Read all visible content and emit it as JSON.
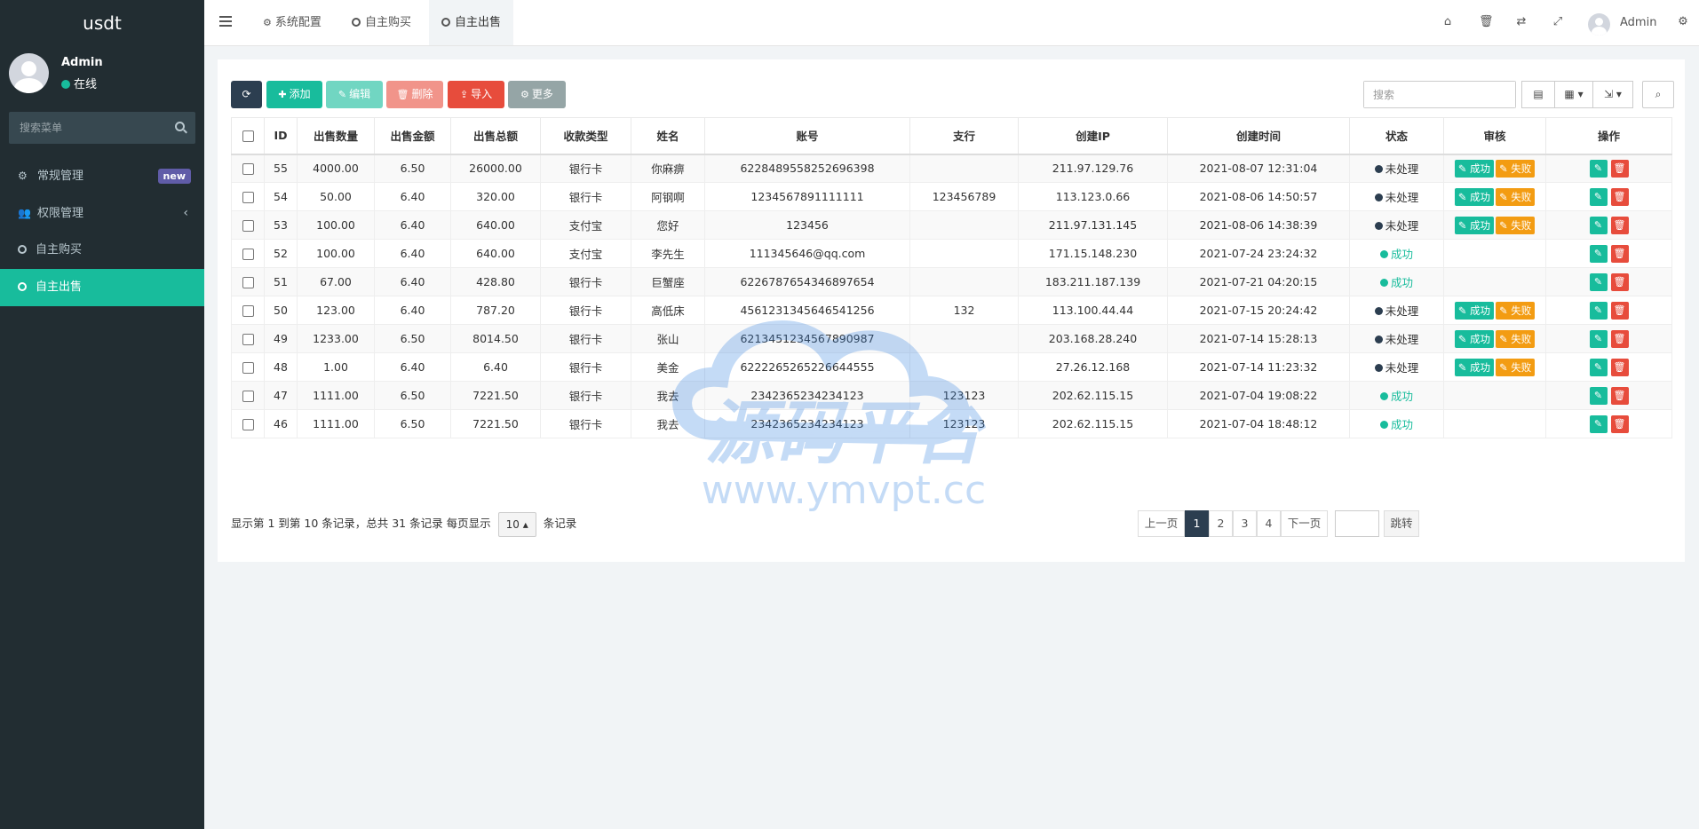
{
  "app": {
    "brand": "usdt"
  },
  "user": {
    "name": "Admin",
    "status": "在线"
  },
  "sidebar": {
    "search_placeholder": "搜索菜单",
    "items": [
      {
        "label": "常规管理",
        "icon": "cogs-icon",
        "badge": "new"
      },
      {
        "label": "权限管理",
        "icon": "users-icon",
        "chevron": "‹"
      },
      {
        "label": "自主购买",
        "icon": "circle-icon"
      },
      {
        "label": "自主出售",
        "icon": "circle-icon",
        "active": true
      }
    ]
  },
  "header": {
    "tabs": [
      {
        "label": "系统配置",
        "icon": "gear-icon"
      },
      {
        "label": "自主购买",
        "icon": "circle-icon"
      },
      {
        "label": "自主出售",
        "icon": "circle-icon",
        "active": true
      }
    ],
    "user_name": "Admin",
    "icons": [
      "home-icon",
      "trash-icon",
      "translate-icon",
      "fullscreen-icon",
      "settings-icon"
    ]
  },
  "toolbar": {
    "refresh_label": "",
    "add_label": "添加",
    "edit_label": "编辑",
    "delete_label": "删除",
    "import_label": "导入",
    "more_label": "更多",
    "search_placeholder": "搜索",
    "colors": {
      "refresh": "#2c3e50",
      "add": "#18bc9c",
      "edit": "#71d6c2",
      "delete": "#f1948a",
      "import": "#e74c3c",
      "more": "#95a5a6"
    }
  },
  "table": {
    "columns": [
      "ID",
      "出售数量",
      "出售金额",
      "出售总额",
      "收款类型",
      "姓名",
      "账号",
      "支行",
      "创建IP",
      "创建时间",
      "状态",
      "审核",
      "操作"
    ],
    "audit_ok": "成功",
    "audit_fail": "失败",
    "rows": [
      {
        "id": "55",
        "qty": "4000.00",
        "price": "6.50",
        "total": "26000.00",
        "type": "银行卡",
        "alipay": false,
        "name": "你麻痹",
        "account": "6228489558252696398",
        "branch": "",
        "ip": "211.97.129.76",
        "time": "2021-08-07 12:31:04",
        "status": "未处理",
        "pending": true
      },
      {
        "id": "54",
        "qty": "50.00",
        "price": "6.40",
        "total": "320.00",
        "type": "银行卡",
        "alipay": false,
        "name": "阿钢啊",
        "account": "1234567891111111",
        "branch": "123456789",
        "ip": "113.123.0.66",
        "time": "2021-08-06 14:50:57",
        "status": "未处理",
        "pending": true
      },
      {
        "id": "53",
        "qty": "100.00",
        "price": "6.40",
        "total": "640.00",
        "type": "支付宝",
        "alipay": true,
        "name": "您好",
        "account": "123456",
        "branch": "",
        "ip": "211.97.131.145",
        "time": "2021-08-06 14:38:39",
        "status": "未处理",
        "pending": true
      },
      {
        "id": "52",
        "qty": "100.00",
        "price": "6.40",
        "total": "640.00",
        "type": "支付宝",
        "alipay": true,
        "name": "李先生",
        "account": "111345646@qq.com",
        "branch": "",
        "ip": "171.15.148.230",
        "time": "2021-07-24 23:24:32",
        "status": "成功",
        "pending": false
      },
      {
        "id": "51",
        "qty": "67.00",
        "price": "6.40",
        "total": "428.80",
        "type": "银行卡",
        "alipay": false,
        "name": "巨蟹座",
        "account": "6226787654346897654",
        "branch": "",
        "ip": "183.211.187.139",
        "time": "2021-07-21 04:20:15",
        "status": "成功",
        "pending": false
      },
      {
        "id": "50",
        "qty": "123.00",
        "price": "6.40",
        "total": "787.20",
        "type": "银行卡",
        "alipay": false,
        "name": "高低床",
        "account": "4561231345646541256",
        "branch": "132",
        "ip": "113.100.44.44",
        "time": "2021-07-15 20:24:42",
        "status": "未处理",
        "pending": true
      },
      {
        "id": "49",
        "qty": "1233.00",
        "price": "6.50",
        "total": "8014.50",
        "type": "银行卡",
        "alipay": false,
        "name": "张山",
        "account": "6213451234567890987",
        "branch": "",
        "ip": "203.168.28.240",
        "time": "2021-07-14 15:28:13",
        "status": "未处理",
        "pending": true
      },
      {
        "id": "48",
        "qty": "1.00",
        "price": "6.40",
        "total": "6.40",
        "type": "银行卡",
        "alipay": false,
        "name": "美金",
        "account": "6222265265226644555",
        "branch": "",
        "ip": "27.26.12.168",
        "time": "2021-07-14 11:23:32",
        "status": "未处理",
        "pending": true
      },
      {
        "id": "47",
        "qty": "1111.00",
        "price": "6.50",
        "total": "7221.50",
        "type": "银行卡",
        "alipay": false,
        "name": "我去",
        "account": "2342365234234123",
        "branch": "123123",
        "ip": "202.62.115.15",
        "time": "2021-07-04 19:08:22",
        "status": "成功",
        "pending": false
      },
      {
        "id": "46",
        "qty": "1111.00",
        "price": "6.50",
        "total": "7221.50",
        "type": "银行卡",
        "alipay": false,
        "name": "我去",
        "account": "2342365234234123",
        "branch": "123123",
        "ip": "202.62.115.15",
        "time": "2021-07-04 18:48:12",
        "status": "成功",
        "pending": false
      }
    ]
  },
  "footer": {
    "info_prefix": "显示第 1 到第 10 条记录，总共 31 条记录 每页显示",
    "page_size": "10",
    "info_suffix": "条记录",
    "prev": "上一页",
    "pages": [
      "1",
      "2",
      "3",
      "4"
    ],
    "current_page": "1",
    "next": "下一页",
    "jump": "跳转"
  },
  "watermark": {
    "title": "源码平台",
    "url": "www.ymvpt.cc"
  }
}
